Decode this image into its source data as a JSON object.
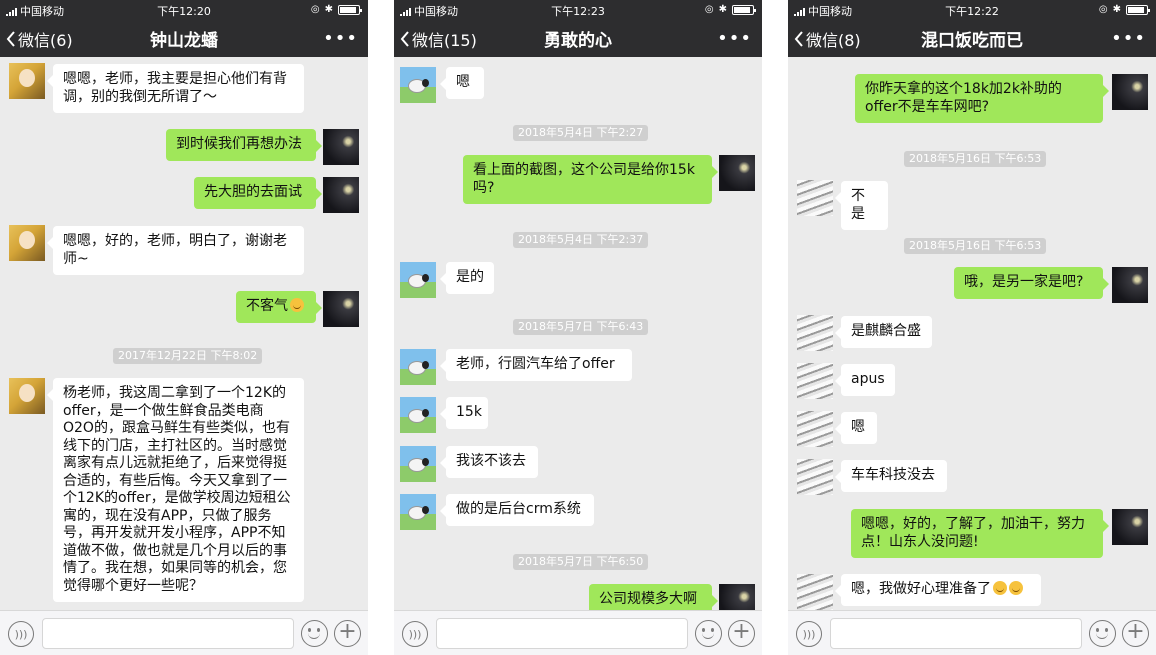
{
  "status_bar": {
    "carrier": "中国移动",
    "time_1": "下午12:20",
    "time_2": "下午12:23",
    "time_3": "下午12:22"
  },
  "panel1": {
    "back_label": "微信(6)",
    "title": "钟山龙蟠",
    "more": "•••",
    "messages": [
      {
        "side": "left",
        "text": "嗯嗯，老师，我主要是担心他们有背调，别的我倒无所谓了～"
      },
      {
        "side": "right",
        "text": "到时候我们再想办法"
      },
      {
        "side": "right",
        "text": "先大胆的去面试"
      },
      {
        "side": "left",
        "text": "嗯嗯，好的，老师，明白了，谢谢老师~"
      },
      {
        "side": "right",
        "text": "不客气"
      },
      {
        "side": "left",
        "text": "杨老师，我这周二拿到了一个12K的offer，是一个做生鲜食品类电商O2O的，跟盒马鲜生有些类似，也有线下的门店，主打社区的。当时感觉离家有点儿远就拒绝了，后来觉得挺合适的，有些后悔。今天又拿到了一个12K的offer，是做学校周边短租公寓的，现在没有APP，只做了服务号，再开发就开发小程序，APP不知道做不做，做也就是几个月以后的事情了。我在想，如果同等的机会，您觉得哪个更好一些呢？"
      }
    ],
    "timestamps": [
      "2017年12月22日 下午8:02"
    ]
  },
  "panel2": {
    "back_label": "微信(15)",
    "title": "勇敢的心",
    "more": "•••",
    "messages": [
      {
        "side": "left",
        "text": "嗯"
      },
      {
        "side": "right",
        "text": "看上面的截图，这个公司是给你15k吗?"
      },
      {
        "side": "left",
        "text": "是的"
      },
      {
        "side": "left",
        "text": "老师，行圆汽车给了offer"
      },
      {
        "side": "left",
        "text": "15k"
      },
      {
        "side": "left",
        "text": "我该不该去"
      },
      {
        "side": "left",
        "text": "做的是后台crm系统"
      },
      {
        "side": "right",
        "text": "公司规模多大啊"
      }
    ],
    "timestamps": [
      "2018年5月4日 下午2:27",
      "2018年5月4日 下午2:37",
      "2018年5月7日 下午6:43",
      "2018年5月7日 下午6:50"
    ]
  },
  "panel3": {
    "back_label": "微信(8)",
    "title": "混口饭吃而已",
    "more": "•••",
    "messages": [
      {
        "side": "right",
        "text": "你昨天拿的这个18k加2k补助的offer不是车车网吧?"
      },
      {
        "side": "left",
        "text": "不是"
      },
      {
        "side": "right",
        "text": "哦，是另一家是吧?"
      },
      {
        "side": "left",
        "text": "是麒麟合盛"
      },
      {
        "side": "left",
        "text": "apus"
      },
      {
        "side": "left",
        "text": "嗯"
      },
      {
        "side": "left",
        "text": "车车科技没去"
      },
      {
        "side": "right",
        "text": "嗯嗯，好的，了解了，加油干，努力点！山东人没问题!"
      },
      {
        "side": "left",
        "text": "嗯，我做好心理准备了"
      }
    ],
    "timestamps": [
      "2018年5月16日 下午6:53",
      "2018年5月16日 下午6:53"
    ]
  }
}
